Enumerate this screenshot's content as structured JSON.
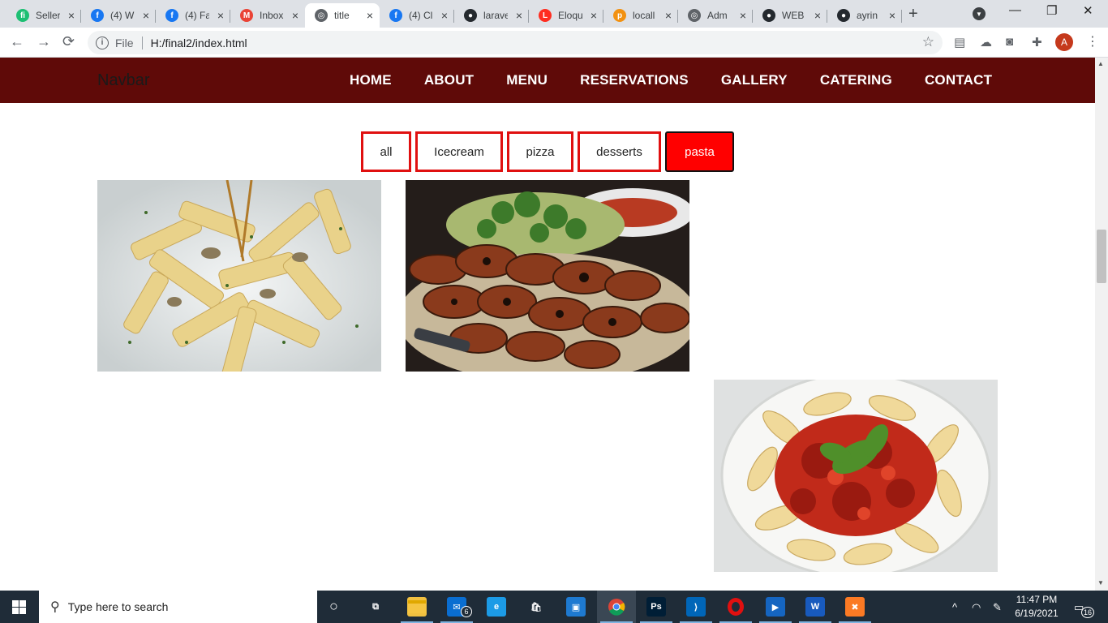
{
  "browser": {
    "tabs": [
      {
        "label": "Seller",
        "icon": "fiverr-icon",
        "color": "#1dbf73",
        "glyph": "fi"
      },
      {
        "label": "(4) W",
        "icon": "facebook-icon",
        "color": "#1877f2",
        "glyph": "f"
      },
      {
        "label": "(4) Fa",
        "icon": "facebook-icon",
        "color": "#1877f2",
        "glyph": "f"
      },
      {
        "label": "Inbox",
        "icon": "gmail-icon",
        "color": "#ea4335",
        "glyph": "M"
      },
      {
        "label": "title",
        "icon": "globe-icon",
        "color": "#5f6368",
        "glyph": "◎"
      },
      {
        "label": "(4) Cl",
        "icon": "facebook-icon",
        "color": "#1877f2",
        "glyph": "f"
      },
      {
        "label": "larave",
        "icon": "github-icon",
        "color": "#24292e",
        "glyph": "●"
      },
      {
        "label": "Eloqu",
        "icon": "laravel-icon",
        "color": "#ff2d20",
        "glyph": "L"
      },
      {
        "label": "locall",
        "icon": "phpmyadmin-icon",
        "color": "#f29111",
        "glyph": "p"
      },
      {
        "label": "Adm",
        "icon": "globe-icon",
        "color": "#5f6368",
        "glyph": "◎"
      },
      {
        "label": "WEB",
        "icon": "github-icon",
        "color": "#24292e",
        "glyph": "●"
      },
      {
        "label": "ayrin",
        "icon": "github-icon",
        "color": "#24292e",
        "glyph": "●"
      }
    ],
    "active_tab": 4,
    "new_tab": "+",
    "minimize": "—",
    "restore": "❐",
    "close": "✕",
    "address": {
      "scheme": "File",
      "url": "H:/final2/index.html"
    },
    "avatar_letter": "A"
  },
  "site": {
    "brand": "Navbar",
    "nav": [
      "HOME",
      "ABOUT",
      "MENU",
      "RESERVATIONS",
      "GALLERY",
      "CATERING",
      "CONTACT"
    ],
    "nav_bg": "#5f0a08",
    "filters": [
      {
        "label": "all",
        "width": 62
      },
      {
        "label": "Icecream",
        "width": 108
      },
      {
        "label": "pizza",
        "width": 82
      },
      {
        "label": "desserts",
        "width": 103
      },
      {
        "label": "pasta",
        "width": 85,
        "active": true
      }
    ],
    "accent": "#ff0000"
  },
  "photos": [
    {
      "name": "creamy-penne-pasta-photo"
    },
    {
      "name": "grilled-chicken-wings-photo"
    },
    {
      "name": "fusilli-tomato-sauce-photo"
    }
  ],
  "taskbar": {
    "search_placeholder": "Type here to search",
    "mail_badge": "6",
    "notif_badge": "16",
    "time": "11:47 PM",
    "date": "6/19/2021",
    "apps": [
      {
        "name": "task-view-icon",
        "glyph": "⧉",
        "bg": "transparent"
      },
      {
        "name": "file-explorer-icon",
        "glyph": "",
        "bg": "#f0c040"
      },
      {
        "name": "mail-icon",
        "glyph": "✉",
        "bg": "#0a6ed1"
      },
      {
        "name": "edge-icon",
        "glyph": "e",
        "bg": "#1c9be6"
      },
      {
        "name": "store-icon",
        "glyph": "🛍",
        "bg": "transparent"
      },
      {
        "name": "todo-icon",
        "glyph": "▣",
        "bg": "#1e7ad1"
      },
      {
        "name": "chrome-icon",
        "glyph": "",
        "bg": "transparent"
      },
      {
        "name": "photoshop-icon",
        "glyph": "Ps",
        "bg": "#001e36"
      },
      {
        "name": "vscode-icon",
        "glyph": "⟩",
        "bg": "#0066b8"
      },
      {
        "name": "opera-icon",
        "glyph": "O",
        "bg": "transparent"
      },
      {
        "name": "video-app-icon",
        "glyph": "▶",
        "bg": "#1565c0"
      },
      {
        "name": "word-icon",
        "glyph": "W",
        "bg": "#185abd"
      },
      {
        "name": "xampp-icon",
        "glyph": "✖",
        "bg": "#fb7a24"
      }
    ]
  }
}
